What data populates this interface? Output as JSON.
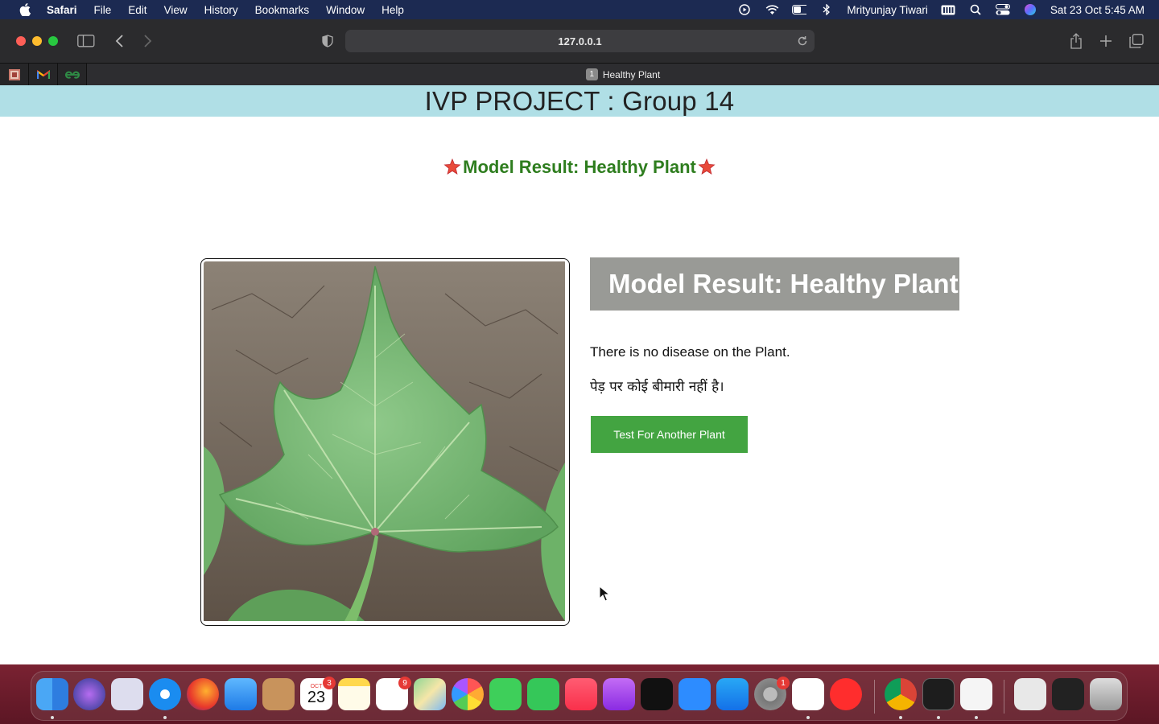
{
  "menubar": {
    "app_name": "Safari",
    "menus": [
      "File",
      "Edit",
      "View",
      "History",
      "Bookmarks",
      "Window",
      "Help"
    ],
    "user_name": "Mrityunjay Tiwari",
    "datetime": "Sat 23 Oct  5:45 AM",
    "status_icons": [
      "play-circle-icon",
      "wifi-icon",
      "battery-icon",
      "bluetooth-icon",
      "keyboard-icon",
      "spotlight-search-icon",
      "control-center-icon",
      "siri-icon"
    ]
  },
  "browser": {
    "url": "127.0.0.1",
    "pinned_tabs": [
      "site-favicon",
      "gmail-favicon",
      "geeksforgeeks-favicon"
    ],
    "active_tab": {
      "number": "1",
      "title": "Healthy Plant"
    }
  },
  "page": {
    "header_title": "IVP PROJECT : Group 14",
    "result_line": "Model Result: Healthy Plant",
    "result_box": "Model Result: Healthy Plant",
    "description_en": "There is no disease on the Plant.",
    "description_hi": "पेड़ पर कोई बीमारी नहीं है।",
    "button_label": "Test For Another Plant"
  },
  "dock": {
    "calendar": {
      "month": "OCT",
      "day": "23",
      "badge": "3"
    },
    "reminders_badge": "9",
    "settings_badge": "1",
    "apps": [
      "finder",
      "siri",
      "launchpad",
      "safari",
      "firefox",
      "mail",
      "contacts",
      "calendar",
      "notes",
      "reminders",
      "maps",
      "photos",
      "messages",
      "facetime",
      "music",
      "podcasts",
      "apple-tv",
      "zoom",
      "app-store",
      "system-preferences",
      "vscode",
      "youtube",
      "chrome",
      "terminal",
      "textedit",
      "preview",
      "folder",
      "trash"
    ]
  },
  "colors": {
    "header_bg": "#b0dfe6",
    "result_green": "#2e7d1e",
    "result_box_bg": "#999a96",
    "button_green": "#43a441"
  }
}
